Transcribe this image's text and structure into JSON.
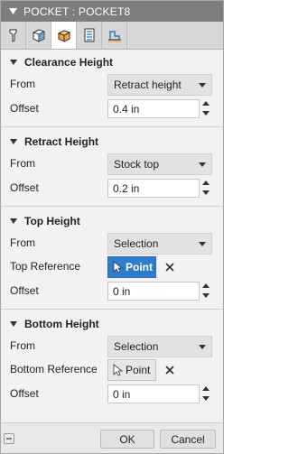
{
  "dialog": {
    "title": "POCKET : POCKET8",
    "tabs": [
      {
        "icon": "tool-icon",
        "active": false
      },
      {
        "icon": "geometry-icon",
        "active": false
      },
      {
        "icon": "heights-icon",
        "active": true
      },
      {
        "icon": "passes-icon",
        "active": false
      },
      {
        "icon": "linking-icon",
        "active": false
      }
    ]
  },
  "clearance": {
    "header": "Clearance Height",
    "from_label": "From",
    "from_value": "Retract height",
    "offset_label": "Offset",
    "offset_value": "0.4 in"
  },
  "retract": {
    "header": "Retract Height",
    "from_label": "From",
    "from_value": "Stock top",
    "offset_label": "Offset",
    "offset_value": "0.2 in"
  },
  "top": {
    "header": "Top Height",
    "from_label": "From",
    "from_value": "Selection",
    "ref_label": "Top Reference",
    "ref_button": "Point",
    "offset_label": "Offset",
    "offset_value": "0 in"
  },
  "bottom": {
    "header": "Bottom Height",
    "from_label": "From",
    "from_value": "Selection",
    "ref_label": "Bottom Reference",
    "ref_button": "Point",
    "offset_label": "Offset",
    "offset_value": "0 in"
  },
  "footer": {
    "ok_label": "OK",
    "cancel_label": "Cancel"
  },
  "colors": {
    "titlebar": "#7d7d7d",
    "accent": "#2f7ccb",
    "panel": "#f2f2f2"
  }
}
